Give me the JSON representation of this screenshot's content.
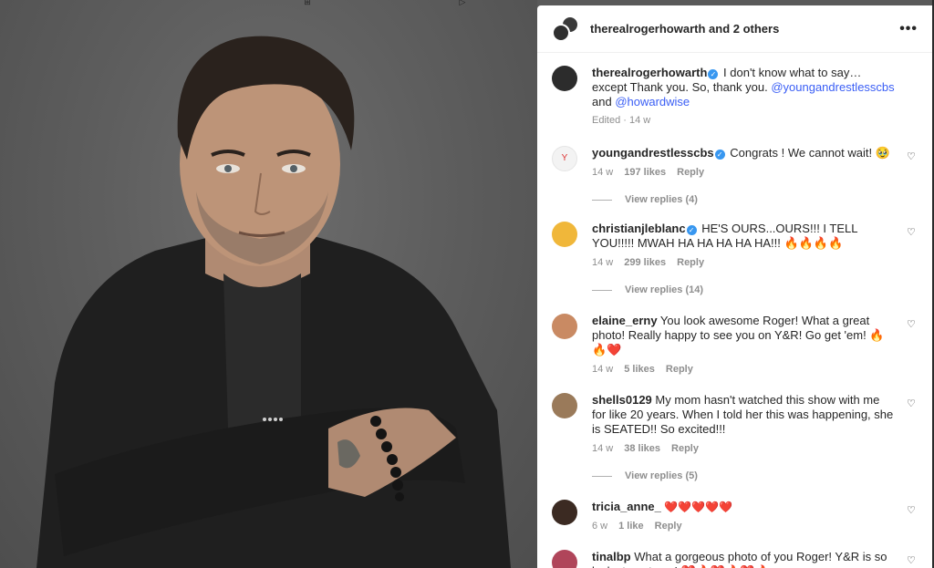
{
  "header": {
    "username": "therealrogerhowarth",
    "others": " and 2 others"
  },
  "caption": {
    "username": "therealrogerhowarth",
    "text_1": " I don't know what to say… except Thank you. So, thank you. ",
    "mention_1": "@youngandrestlesscbs",
    "text_2": " and ",
    "mention_2": "@howardwise",
    "meta": "Edited · 14 w"
  },
  "comments": [
    {
      "username": "youngandrestlesscbs",
      "verified": true,
      "text": " Congrats ! We cannot wait! 🥹",
      "time": "14 w",
      "likes": "197 likes",
      "reply": "Reply",
      "view_replies": "View replies (4)",
      "avatar_color": "#f3f3f3"
    },
    {
      "username": "christianjleblanc",
      "verified": true,
      "text": " HE'S OURS...OURS!!! I TELL YOU!!!!! MWAH HA HA HA HA HA!!! 🔥🔥🔥🔥",
      "time": "14 w",
      "likes": "299 likes",
      "reply": "Reply",
      "view_replies": "View replies (14)",
      "avatar_color": "#f0b73a"
    },
    {
      "username": "elaine_erny",
      "verified": false,
      "text": " You look awesome Roger! What a great photo! Really happy to see you on Y&R! Go get 'em! 🔥🔥❤️",
      "time": "14 w",
      "likes": "5 likes",
      "reply": "Reply",
      "avatar_color": "#c98a63"
    },
    {
      "username": "shells0129",
      "verified": false,
      "text": " My mom hasn't watched this show with me for like 20 years. When I told her this was happening, she is SEATED!! So excited!!!",
      "time": "14 w",
      "likes": "38 likes",
      "reply": "Reply",
      "view_replies": "View replies (5)",
      "avatar_color": "#9a7a5a"
    },
    {
      "username": "tricia_anne_",
      "verified": false,
      "text": " ❤️❤️❤️❤️❤️",
      "time": "6 w",
      "likes": "1 like",
      "reply": "Reply",
      "avatar_color": "#3b2a22"
    },
    {
      "username": "tinalbp",
      "verified": false,
      "text": " What a gorgeous photo of you Roger! Y&R is so lucky to get you! ❤️🔥❤️🔥❤️🔥",
      "time": "",
      "likes": "",
      "reply": "",
      "avatar_color": "#b0455a"
    }
  ],
  "icons": {
    "more": "more-options-icon",
    "heart": "heart-outline-icon"
  },
  "colors": {
    "mention": "#3a5ef5",
    "verified": "#3897f0",
    "meta": "#8e8e8e"
  }
}
